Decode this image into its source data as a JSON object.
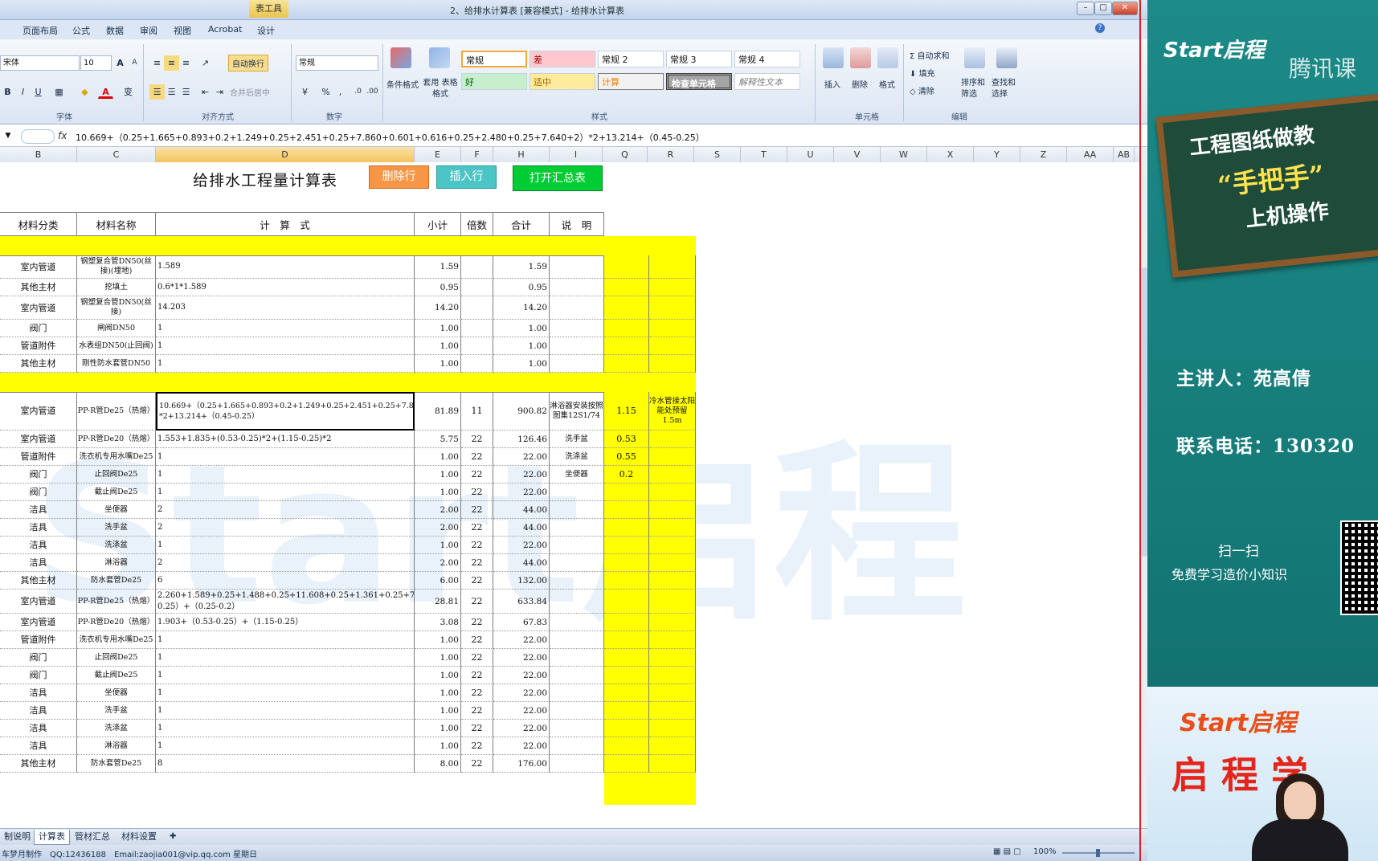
{
  "window": {
    "title": "2、给排水计算表 [兼容模式] - 给排水计算表",
    "context_tab": "表工具"
  },
  "menu_tabs": [
    "页面布局",
    "公式",
    "数据",
    "审阅",
    "视图",
    "Acrobat",
    "设计"
  ],
  "ribbon": {
    "font": {
      "name": "宋体",
      "size": "10",
      "label": "字体",
      "bold": "B",
      "italic": "I",
      "underline": "U",
      "grow": "A",
      "shrink": "A",
      "color": "A",
      "pinyin": "变"
    },
    "align": {
      "wrap": "自动换行",
      "merge": "合并后居中",
      "label": "对齐方式"
    },
    "number": {
      "format": "常规",
      "label": "数字",
      "percent": "%",
      "comma": ","
    },
    "styles": {
      "cond_format": "条件格式",
      "table_format": "套用 表格格式",
      "label": "样式",
      "cells": [
        "常规",
        "差",
        "常规 2",
        "常规 3",
        "常规 4",
        "好",
        "适中",
        "计算",
        "检查单元格",
        "解释性文本"
      ]
    },
    "cells_group": {
      "insert": "插入",
      "delete": "删除",
      "format": "格式",
      "label": "单元格"
    },
    "editing": {
      "autosum": "自动求和",
      "fill": "填充",
      "clear": "清除",
      "sort": "排序和 筛选",
      "find": "查找和 选择",
      "label": "编辑"
    }
  },
  "formula_bar": {
    "fx": "fx",
    "content": "10.669+（0.25+1.665+0.893+0.2+1.249+0.25+2.451+0.25+7.860+0.601+0.616+0.25+2.480+0.25+7.640+2）*2+13.214+（0.45-0.25）"
  },
  "columns": [
    "B",
    "C",
    "D",
    "E",
    "F",
    "H",
    "I",
    "Q",
    "R",
    "S",
    "T",
    "U",
    "V",
    "W",
    "X",
    "Y",
    "Z",
    "AA",
    "AB"
  ],
  "sheet": {
    "title": "给排水工程量计算表",
    "buttons": {
      "delete_row": "删除行",
      "insert_row": "插入行",
      "open_summary": "打开汇总表"
    },
    "headers": [
      "材料分类",
      "材料名称",
      "计　算　式",
      "小计",
      "倍数",
      "合计",
      "说　明"
    ],
    "rows": [
      {
        "cat": "室内管道",
        "name": "钢塑复合管DN50(丝接)(埋地)",
        "formula": "1.589",
        "sub": "1.59",
        "mult": "",
        "total": "1.59",
        "note": "",
        "q": "",
        "r": ""
      },
      {
        "cat": "其他主材",
        "name": "挖填土",
        "formula": "0.6*1*1.589",
        "sub": "0.95",
        "mult": "",
        "total": "0.95",
        "note": "",
        "q": "",
        "r": ""
      },
      {
        "cat": "室内管道",
        "name": "钢塑复合管DN50(丝接)",
        "formula": "14.203",
        "sub": "14.20",
        "mult": "",
        "total": "14.20",
        "note": "",
        "q": "",
        "r": ""
      },
      {
        "cat": "阀门",
        "name": "闸阀DN50",
        "formula": "1",
        "sub": "1.00",
        "mult": "",
        "total": "1.00",
        "note": "",
        "q": "",
        "r": ""
      },
      {
        "cat": "管道附件",
        "name": "水表组DN50(止回阀)",
        "formula": "1",
        "sub": "1.00",
        "mult": "",
        "total": "1.00",
        "note": "",
        "q": "",
        "r": ""
      },
      {
        "cat": "其他主材",
        "name": "刚性防水套管DN50",
        "formula": "1",
        "sub": "1.00",
        "mult": "",
        "total": "1.00",
        "note": "",
        "q": "",
        "r": ""
      },
      {
        "cat": "室内管道",
        "name": "PP-R管De25（热熔）",
        "formula": "10.669+（0.25+1.665+0.893+0.2+1.249+0.25+2.451+0.25+7.860+0.601+0.616+0.25+2.480+0.25+7.640+2）*2+13.214+（0.45-0.25）",
        "sub": "81.89",
        "mult": "11",
        "total": "900.82",
        "note": "淋浴器安装按照图集12S1/74",
        "q": "1.15",
        "r": "冷水管接太阳能处预留1.5m"
      },
      {
        "cat": "室内管道",
        "name": "PP-R管De20（热熔）",
        "formula": "1.553+1.835+(0.53-0.25)*2+(1.15-0.25)*2",
        "sub": "5.75",
        "mult": "22",
        "total": "126.46",
        "note": "洗手盆",
        "q": "0.53",
        "r": ""
      },
      {
        "cat": "管道附件",
        "name": "洗衣机专用水嘴De25",
        "formula": "1",
        "sub": "1.00",
        "mult": "22",
        "total": "22.00",
        "note": "洗涤盆",
        "q": "0.55",
        "r": ""
      },
      {
        "cat": "阀门",
        "name": "止回阀De25",
        "formula": "1",
        "sub": "1.00",
        "mult": "22",
        "total": "22.00",
        "note": "坐便器",
        "q": "0.2",
        "r": ""
      },
      {
        "cat": "阀门",
        "name": "截止阀De25",
        "formula": "1",
        "sub": "1.00",
        "mult": "22",
        "total": "22.00",
        "note": "",
        "q": "",
        "r": ""
      },
      {
        "cat": "洁具",
        "name": "坐便器",
        "formula": "2",
        "sub": "2.00",
        "mult": "22",
        "total": "44.00",
        "note": "",
        "q": "",
        "r": ""
      },
      {
        "cat": "洁具",
        "name": "洗手盆",
        "formula": "2",
        "sub": "2.00",
        "mult": "22",
        "total": "44.00",
        "note": "",
        "q": "",
        "r": ""
      },
      {
        "cat": "洁具",
        "name": "洗涤盆",
        "formula": "1",
        "sub": "1.00",
        "mult": "22",
        "total": "22.00",
        "note": "",
        "q": "",
        "r": ""
      },
      {
        "cat": "洁具",
        "name": "淋浴器",
        "formula": "2",
        "sub": "2.00",
        "mult": "22",
        "total": "44.00",
        "note": "",
        "q": "",
        "r": ""
      },
      {
        "cat": "其他主材",
        "name": "防水套管De25",
        "formula": "6",
        "sub": "6.00",
        "mult": "22",
        "total": "132.00",
        "note": "",
        "q": "",
        "r": ""
      },
      {
        "cat": "室内管道",
        "name": "PP-R管De25（热熔）",
        "formula": "2.260+1.589+0.25+1.488+0.25+11.608+0.25+1.361+0.25+7.655+1.5+（0.55-0.25）+（0.25-0.2）",
        "sub": "28.81",
        "mult": "22",
        "total": "633.84",
        "note": "",
        "q": "",
        "r": ""
      },
      {
        "cat": "室内管道",
        "name": "PP-R管De20（热熔）",
        "formula": "1.903+（0.53-0.25）+（1.15-0.25）",
        "sub": "3.08",
        "mult": "22",
        "total": "67.83",
        "note": "",
        "q": "",
        "r": ""
      },
      {
        "cat": "管道附件",
        "name": "洗衣机专用水嘴De25",
        "formula": "1",
        "sub": "1.00",
        "mult": "22",
        "total": "22.00",
        "note": "",
        "q": "",
        "r": ""
      },
      {
        "cat": "阀门",
        "name": "止回阀De25",
        "formula": "1",
        "sub": "1.00",
        "mult": "22",
        "total": "22.00",
        "note": "",
        "q": "",
        "r": ""
      },
      {
        "cat": "阀门",
        "name": "截止阀De25",
        "formula": "1",
        "sub": "1.00",
        "mult": "22",
        "total": "22.00",
        "note": "",
        "q": "",
        "r": ""
      },
      {
        "cat": "洁具",
        "name": "坐便器",
        "formula": "1",
        "sub": "1.00",
        "mult": "22",
        "total": "22.00",
        "note": "",
        "q": "",
        "r": ""
      },
      {
        "cat": "洁具",
        "name": "洗手盆",
        "formula": "1",
        "sub": "1.00",
        "mult": "22",
        "total": "22.00",
        "note": "",
        "q": "",
        "r": ""
      },
      {
        "cat": "洁具",
        "name": "洗涤盆",
        "formula": "1",
        "sub": "1.00",
        "mult": "22",
        "total": "22.00",
        "note": "",
        "q": "",
        "r": ""
      },
      {
        "cat": "洁具",
        "name": "淋浴器",
        "formula": "1",
        "sub": "1.00",
        "mult": "22",
        "total": "22.00",
        "note": "",
        "q": "",
        "r": ""
      },
      {
        "cat": "其他主材",
        "name": "防水套管De25",
        "formula": "8",
        "sub": "8.00",
        "mult": "22",
        "total": "176.00",
        "note": "",
        "q": "",
        "r": ""
      }
    ]
  },
  "sheet_tabs": [
    "制说明",
    "计算表",
    "管材汇总",
    "材料设置"
  ],
  "status": {
    "left": "车梦月制作　QQ:12436188　Email:zaojia001@vip.qq.com 星期日",
    "zoom": "100%"
  },
  "right_panel": {
    "logo": "Start启程",
    "tencent": "腾讯课",
    "board_line1": "工程图纸做教",
    "board_line2": "“手把手”",
    "board_line3": "上机操作",
    "speaker": "主讲人：苑高倩",
    "phone": "联系电话：130320",
    "scan": "扫一扫",
    "scan_sub": "免费学习造价小知识",
    "bottom_logo": "Start启程",
    "bottom_text": "启 程 学"
  },
  "colors": {
    "yellow": "#ffff00",
    "delete_btn": "#f79646",
    "insert_btn": "#4bc5c5",
    "summary_btn": "#00cc33",
    "panel": "#157a78"
  }
}
